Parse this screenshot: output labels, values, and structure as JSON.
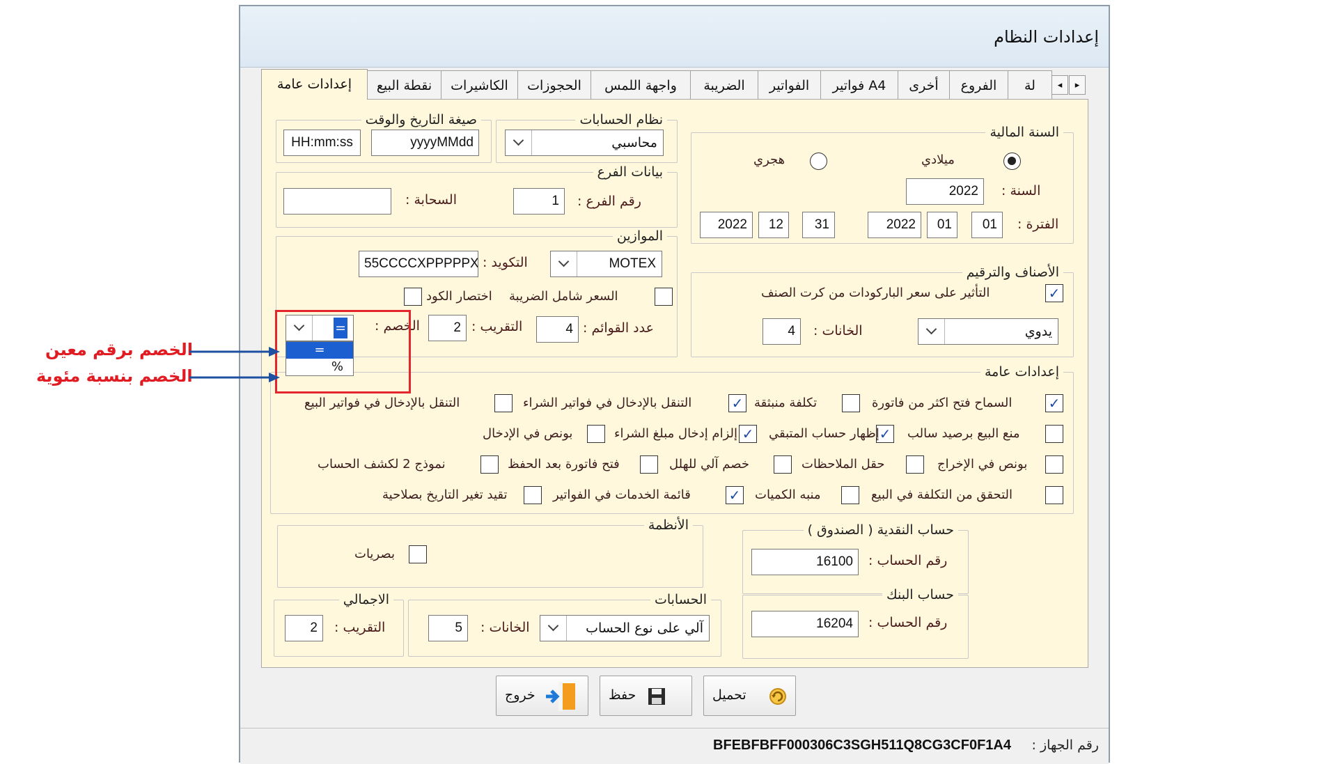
{
  "window": {
    "title": "إعدادات النظام"
  },
  "tabs": [
    "إعدادات عامة",
    "نقطة البيع",
    "الكاشيرات",
    "الحجوزات",
    "واجهة اللمس",
    "الضريبة",
    "الفواتير",
    "فواتير A4",
    "أخرى",
    "الفروع",
    "لة"
  ],
  "tab_scroll": {
    "left": "◂",
    "right": "▸"
  },
  "datetime_format": {
    "label": "صيغة التاريخ والوقت",
    "time": "HH:mm:ss",
    "date": "yyyyMMdd"
  },
  "accounts_system": {
    "label": "نظام الحسابات",
    "value": "محاسبي"
  },
  "branch_data": {
    "label": "بيانات الفرع",
    "branch_no_label": "رقم الفرع :",
    "branch_no": "1",
    "cloud_label": "السحابة :",
    "cloud_value": ""
  },
  "scales": {
    "label": "الموازين",
    "scale_value": "MOTEX",
    "code_label": "التكويد :",
    "code_value": "55CCCCXPPPPPX",
    "price_incl_tax": "السعر شامل الضريبة",
    "code_shortcut": "اختصار الكود",
    "lists_label": "عدد القوائم :",
    "lists_value": "4",
    "rounding_label": "التقريب :",
    "rounding_value": "2",
    "discount_label": "الخصم :",
    "discount_value": "=",
    "discount_options": [
      "=",
      "%"
    ]
  },
  "fiscal_year": {
    "label": "السنة المالية",
    "gregorian": "ميلادي",
    "hijri": "هجري",
    "year_label": "السنة :",
    "year": "2022",
    "period_label": "الفترة :",
    "from_day": "01",
    "from_month": "01",
    "from_year": "2022",
    "to_day": "31",
    "to_month": "12",
    "to_year": "2022"
  },
  "items_numbering": {
    "label": "الأصناف والترقيم",
    "barcode_price": "التأثير على سعر الباركودات من كرت الصنف",
    "mode_value": "يدوي",
    "digits_label": "الخانات :",
    "digits_value": "4"
  },
  "general": {
    "label": "إعدادات عامة",
    "rows": [
      [
        {
          "text": "السماح فتح اكثر من فاتورة",
          "checked": true
        },
        {
          "text": "تكلفة منبثقة",
          "checked": false
        },
        {
          "text": "التنقل بالإدخال في فواتير الشراء",
          "checked": true
        },
        {
          "text": "التنقل بالإدخال في فواتير البيع",
          "checked": false
        }
      ],
      [
        {
          "text": "منع البيع برصيد سالب",
          "checked": false
        },
        {
          "text": "إظهار حساب المتبقي",
          "checked": true
        },
        {
          "text": "إلزام إدخال مبلغ الشراء",
          "checked": true
        },
        {
          "text": "بونص في الإدخال",
          "checked": false
        }
      ],
      [
        {
          "text": "بونص في الإخراج",
          "checked": false
        },
        {
          "text": "حقل الملاحظات",
          "checked": false
        },
        {
          "text": "خصم آلي للهلل",
          "checked": false
        },
        {
          "text": "فتح فاتورة بعد الحفظ",
          "checked": false
        },
        {
          "text": "نموذج 2 لكشف الحساب",
          "checked": false
        }
      ],
      [
        {
          "text": "التحقق من التكلفة في البيع",
          "checked": false
        },
        {
          "text": "منبه الكميات",
          "checked": false
        },
        {
          "text": "قائمة الخدمات في الفواتير",
          "checked": true
        },
        {
          "text": "تقيد تغير التاريخ بصلاحية",
          "checked": false
        }
      ]
    ]
  },
  "systems": {
    "label": "الأنظمة",
    "optics": "بصريات"
  },
  "cash_account": {
    "label": "حساب النقدية ( الصندوق )",
    "acc_label": "رقم الحساب :",
    "acc_value": "16100"
  },
  "bank_account": {
    "label": "حساب البنك",
    "acc_label": "رقم الحساب :",
    "acc_value": "16204"
  },
  "accounts": {
    "label": "الحسابات",
    "mode_value": "آلي على نوع الحساب",
    "digits_label": "الخانات :",
    "digits_value": "5"
  },
  "totals": {
    "label": "الاجمالي",
    "rounding_label": "التقريب :",
    "rounding_value": "2"
  },
  "buttons": {
    "load": "تحميل",
    "save": "حفظ",
    "exit": "خروج"
  },
  "status": {
    "device_label": "رقم الجهاز :",
    "device_id": "BFEBFBFF000306C3SGH511Q8CG3CF0F1A4"
  },
  "annotations": {
    "fixed_discount": "الخصم برقم معين",
    "percent_discount": "الخصم بنسبة مئوية"
  },
  "colors": {
    "page_bg": "#fff8dc",
    "annotation": "#e11b22",
    "arrow": "#1e50a2",
    "check": "#1d4aa5"
  },
  "icons": {
    "tab_left": "arrow-left-icon",
    "tab_right": "arrow-right-icon",
    "load": "load-icon",
    "save": "floppy-save-icon",
    "exit": "exit-door-icon"
  }
}
